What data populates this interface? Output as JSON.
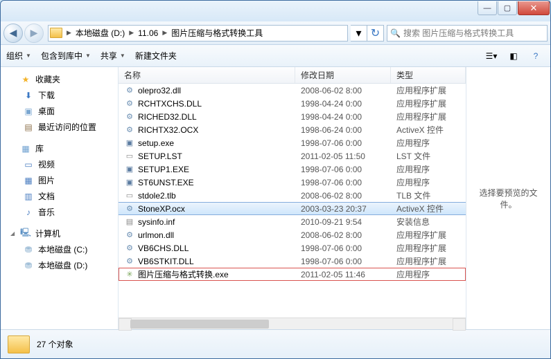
{
  "breadcrumb": [
    "本地磁盘 (D:)",
    "11.06",
    "图片压缩与格式转换工具"
  ],
  "search_placeholder": "搜索 图片压缩与格式转换工具",
  "toolbar": {
    "organize": "组织",
    "include": "包含到库中",
    "share": "共享",
    "newfolder": "新建文件夹"
  },
  "columns": {
    "name": "名称",
    "date": "修改日期",
    "type": "类型"
  },
  "sidebar": {
    "fav": {
      "label": "收藏夹",
      "items": [
        {
          "icon": "download-icon",
          "label": "下载"
        },
        {
          "icon": "desktop-icon",
          "label": "桌面"
        },
        {
          "icon": "recent-icon",
          "label": "最近访问的位置"
        }
      ]
    },
    "lib": {
      "label": "库",
      "items": [
        {
          "icon": "video-icon",
          "label": "视频"
        },
        {
          "icon": "picture-icon",
          "label": "图片"
        },
        {
          "icon": "document-icon",
          "label": "文档"
        },
        {
          "icon": "music-icon",
          "label": "音乐"
        }
      ]
    },
    "comp": {
      "label": "计算机",
      "items": [
        {
          "icon": "drive-icon",
          "label": "本地磁盘 (C:)"
        },
        {
          "icon": "drive-icon",
          "label": "本地磁盘 (D:)"
        }
      ]
    }
  },
  "files": [
    {
      "icon": "dll",
      "name": "olepro32.dll",
      "date": "2008-06-02 8:00",
      "type": "应用程序扩展"
    },
    {
      "icon": "dll",
      "name": "RCHTXCHS.DLL",
      "date": "1998-04-24 0:00",
      "type": "应用程序扩展"
    },
    {
      "icon": "dll",
      "name": "RICHED32.DLL",
      "date": "1998-04-24 0:00",
      "type": "应用程序扩展"
    },
    {
      "icon": "ocx",
      "name": "RICHTX32.OCX",
      "date": "1998-06-24 0:00",
      "type": "ActiveX 控件"
    },
    {
      "icon": "exe",
      "name": "setup.exe",
      "date": "1998-07-06 0:00",
      "type": "应用程序"
    },
    {
      "icon": "doc",
      "name": "SETUP.LST",
      "date": "2011-02-05 11:50",
      "type": "LST 文件"
    },
    {
      "icon": "exe",
      "name": "SETUP1.EXE",
      "date": "1998-07-06 0:00",
      "type": "应用程序"
    },
    {
      "icon": "exe",
      "name": "ST6UNST.EXE",
      "date": "1998-07-06 0:00",
      "type": "应用程序"
    },
    {
      "icon": "tlb",
      "name": "stdole2.tlb",
      "date": "2008-06-02 8:00",
      "type": "TLB 文件"
    },
    {
      "icon": "ocx",
      "name": "StoneXP.ocx",
      "date": "2003-03-23 20:37",
      "type": "ActiveX 控件",
      "selected": true
    },
    {
      "icon": "inf",
      "name": "sysinfo.inf",
      "date": "2010-09-21 9:54",
      "type": "安装信息"
    },
    {
      "icon": "dll",
      "name": "urlmon.dll",
      "date": "2008-06-02 8:00",
      "type": "应用程序扩展"
    },
    {
      "icon": "dll",
      "name": "VB6CHS.DLL",
      "date": "1998-07-06 0:00",
      "type": "应用程序扩展"
    },
    {
      "icon": "dll",
      "name": "VB6STKIT.DLL",
      "date": "1998-07-06 0:00",
      "type": "应用程序扩展"
    },
    {
      "icon": "app",
      "name": "图片压缩与格式转换.exe",
      "date": "2011-02-05 11:46",
      "type": "应用程序",
      "highlight": true
    }
  ],
  "preview_text": "选择要预览的文件。",
  "status_text": "27 个对象"
}
